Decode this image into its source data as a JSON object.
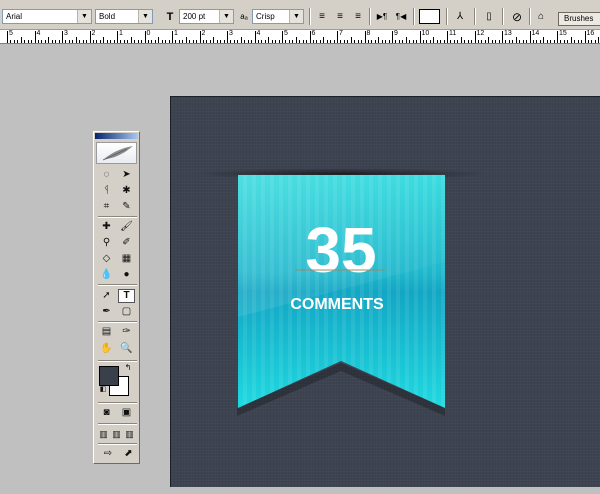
{
  "options_bar": {
    "font_family": "Arial",
    "font_style": "Bold",
    "font_size": "200 pt",
    "antialias_symbol": "aₐ",
    "antialias": "Crisp",
    "text_color": "#ffffff",
    "palette_tab": "Brushes"
  },
  "ruler": {
    "labels": [
      "5",
      "4",
      "3",
      "2",
      "1",
      "0",
      "1",
      "2",
      "3",
      "4",
      "5",
      "6",
      "7",
      "8",
      "9",
      "10",
      "11",
      "12",
      "13",
      "14",
      "15",
      "16"
    ]
  },
  "canvas": {
    "background_color": "#3d4350",
    "badge": {
      "number": "35",
      "label": "COMMENTS",
      "color": "#1fc9d9"
    }
  },
  "toolbox": {
    "foreground_color": "#3a3f4c",
    "background_color": "#ffffff",
    "header_icon": "feather-icon"
  }
}
